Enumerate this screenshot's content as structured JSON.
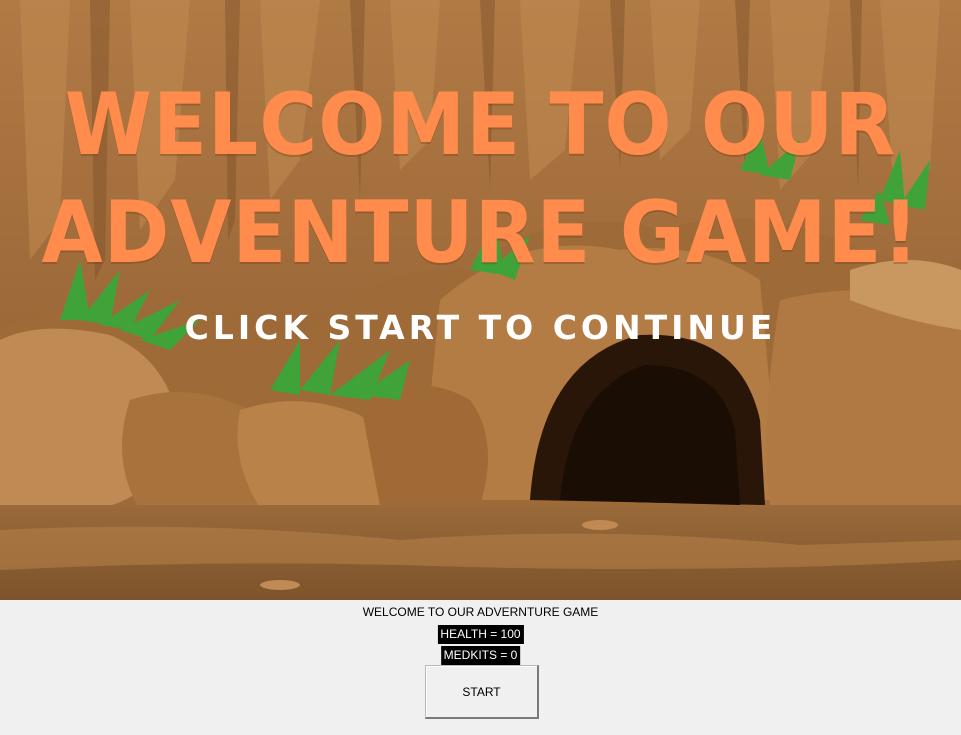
{
  "scene": {
    "headline_line1": "WELCOME TO OUR",
    "headline_line2": "ADVENTURE GAME!",
    "subline": "CLICK START TO CONTINUE",
    "headline_color": "#ff8c4d",
    "subline_color": "#ffffff"
  },
  "panel": {
    "welcome": "WELCOME TO OUR ADVERNTURE GAME",
    "health": "HEALTH = 100",
    "medkits": "MEDKITS = 0",
    "start_label": "START"
  }
}
